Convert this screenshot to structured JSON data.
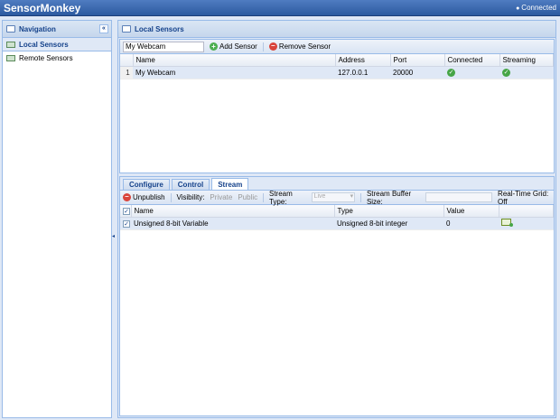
{
  "app": {
    "title": "SensorMonkey",
    "status": "Connected"
  },
  "navigation": {
    "title": "Navigation",
    "collapse_glyph": "«",
    "items": [
      {
        "label": "Local Sensors"
      },
      {
        "label": "Remote Sensors"
      }
    ]
  },
  "local_sensors": {
    "title": "Local Sensors",
    "toolbar": {
      "sensor_name_value": "My Webcam",
      "add_label": "Add Sensor",
      "remove_label": "Remove Sensor"
    },
    "columns": [
      "Name",
      "Address",
      "Port",
      "Connected",
      "Streaming"
    ],
    "rows": [
      {
        "num": "1",
        "name": "My Webcam",
        "address": "127.0.0.1",
        "port": "20000",
        "connected": true,
        "streaming": true
      }
    ]
  },
  "detail": {
    "tabs": [
      "Configure",
      "Control",
      "Stream"
    ],
    "active_tab": "Stream",
    "toolbar": {
      "unpublish_label": "Unpublish",
      "visibility_label": "Visibility:",
      "private_label": "Private",
      "public_label": "Public",
      "stream_type_label": "Stream Type:",
      "stream_type_value": "Live",
      "buffer_label": "Stream Buffer Size:",
      "realtime_label": "Real-Time Grid: Off"
    },
    "columns": [
      "Name",
      "Type",
      "Value"
    ],
    "rows": [
      {
        "checked": true,
        "name": "Unsigned 8-bit Variable",
        "type": "Unsigned 8-bit integer",
        "value": "0"
      }
    ]
  },
  "colors": {
    "header_blue": "#2c5aa0",
    "panel_border": "#99bbe8",
    "selection": "#dfe8f6",
    "ok_green": "#46a546",
    "remove_red": "#d9443b"
  },
  "icons": {
    "add": "plus-circle-icon",
    "remove": "minus-circle-icon",
    "connected": "check-circle-icon",
    "plot": "chart-icon"
  }
}
